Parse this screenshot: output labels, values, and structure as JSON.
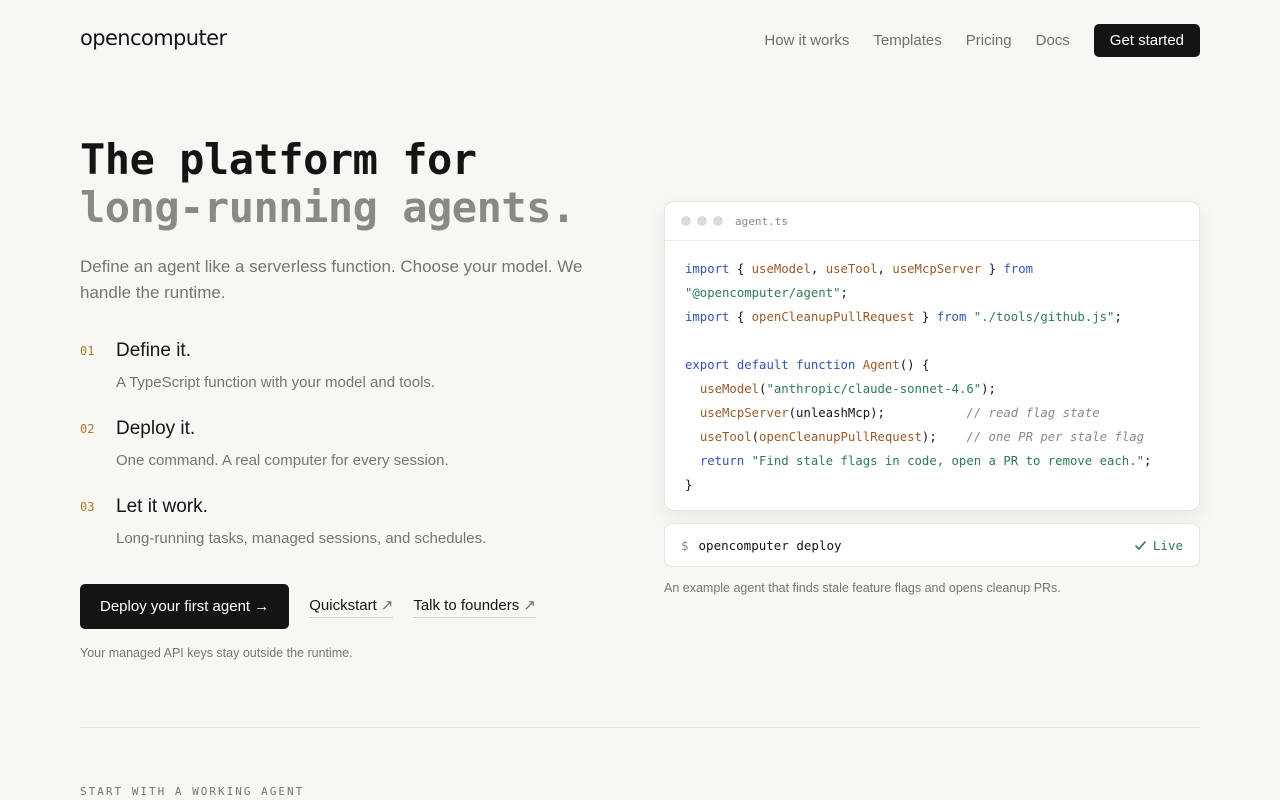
{
  "brand": {
    "name": "opencomputer"
  },
  "nav": {
    "items": [
      "How it works",
      "Templates",
      "Pricing",
      "Docs"
    ],
    "cta": "Get started"
  },
  "hero": {
    "title_line1": "The platform for",
    "title_line2": "long-running agents.",
    "subtitle": "Define an agent like a serverless function. Choose your model. We handle the runtime."
  },
  "steps": [
    {
      "num": "01",
      "title": "Define it.",
      "desc": "A TypeScript function with your model and tools."
    },
    {
      "num": "02",
      "title": "Deploy it.",
      "desc": "One command. A real computer for every session."
    },
    {
      "num": "03",
      "title": "Let it work.",
      "desc": "Long-running tasks, managed sessions, and schedules."
    }
  ],
  "actions": {
    "primary": "Deploy your first agent →",
    "quickstart": "Quickstart",
    "founders": "Talk to founders",
    "external_icon": "↗",
    "note": "Your managed API keys stay outside the runtime."
  },
  "code": {
    "filename": "agent.ts",
    "lines": [
      [
        [
          "kw",
          "import"
        ],
        [
          "p",
          " { "
        ],
        [
          "fn",
          "useModel"
        ],
        [
          "p",
          ", "
        ],
        [
          "fn",
          "useTool"
        ],
        [
          "p",
          ", "
        ],
        [
          "fn",
          "useMcpServer"
        ],
        [
          "p",
          " } "
        ],
        [
          "kw",
          "from"
        ]
      ],
      [
        [
          "str",
          "\"@opencomputer/agent\""
        ],
        [
          "p",
          ";"
        ]
      ],
      [
        [
          "kw",
          "import"
        ],
        [
          "p",
          " { "
        ],
        [
          "fn",
          "openCleanupPullRequest"
        ],
        [
          "p",
          " } "
        ],
        [
          "kw",
          "from"
        ],
        [
          "p",
          " "
        ],
        [
          "str",
          "\"./tools/github.js\""
        ],
        [
          "p",
          ";"
        ]
      ],
      [
        [
          "p",
          ""
        ]
      ],
      [
        [
          "kw",
          "export"
        ],
        [
          "p",
          " "
        ],
        [
          "kw",
          "default"
        ],
        [
          "p",
          " "
        ],
        [
          "kw",
          "function"
        ],
        [
          "p",
          " "
        ],
        [
          "fn",
          "Agent"
        ],
        [
          "p",
          "() {"
        ]
      ],
      [
        [
          "p",
          "  "
        ],
        [
          "fn",
          "useModel"
        ],
        [
          "p",
          "("
        ],
        [
          "str",
          "\"anthropic/claude-sonnet-4.6\""
        ],
        [
          "p",
          ");"
        ]
      ],
      [
        [
          "p",
          "  "
        ],
        [
          "fn",
          "useMcpServer"
        ],
        [
          "p",
          "(unleashMcp);           "
        ],
        [
          "cm",
          "// read flag state"
        ]
      ],
      [
        [
          "p",
          "  "
        ],
        [
          "fn",
          "useTool"
        ],
        [
          "p",
          "("
        ],
        [
          "fn",
          "openCleanupPullRequest"
        ],
        [
          "p",
          ");    "
        ],
        [
          "cm",
          "// one PR per stale flag"
        ]
      ],
      [
        [
          "p",
          "  "
        ],
        [
          "kw",
          "return"
        ],
        [
          "p",
          " "
        ],
        [
          "str",
          "\"Find stale flags in code, open a PR to remove each.\""
        ],
        [
          "p",
          ";"
        ]
      ],
      [
        [
          "p",
          "}"
        ]
      ]
    ]
  },
  "deploy": {
    "prompt": "$",
    "command": "opencomputer deploy",
    "status": "Live",
    "status_icon": "check-icon"
  },
  "caption": "An example agent that finds stale feature flags and opens cleanup PRs.",
  "section": {
    "label": "START WITH A WORKING AGENT"
  }
}
